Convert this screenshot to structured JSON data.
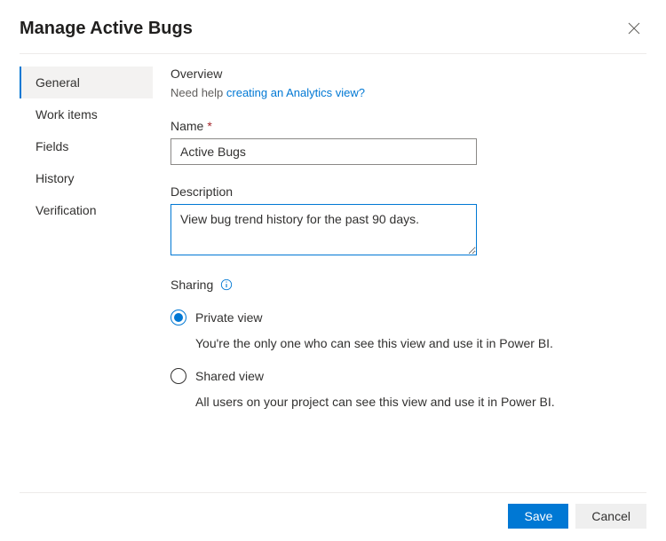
{
  "header": {
    "title": "Manage Active Bugs"
  },
  "tabs": [
    {
      "label": "General"
    },
    {
      "label": "Work items"
    },
    {
      "label": "Fields"
    },
    {
      "label": "History"
    },
    {
      "label": "Verification"
    }
  ],
  "overview": {
    "title": "Overview",
    "help_prefix": "Need help ",
    "help_link": "creating an Analytics view?"
  },
  "name_field": {
    "label": "Name",
    "value": "Active Bugs"
  },
  "description_field": {
    "label": "Description",
    "value": "View bug trend history for the past 90 days."
  },
  "sharing": {
    "label": "Sharing",
    "options": [
      {
        "label": "Private view",
        "desc": "You're the only one who can see this view and use it in Power BI."
      },
      {
        "label": "Shared view",
        "desc": "All users on your project can see this view and use it in Power BI."
      }
    ]
  },
  "footer": {
    "save": "Save",
    "cancel": "Cancel"
  }
}
